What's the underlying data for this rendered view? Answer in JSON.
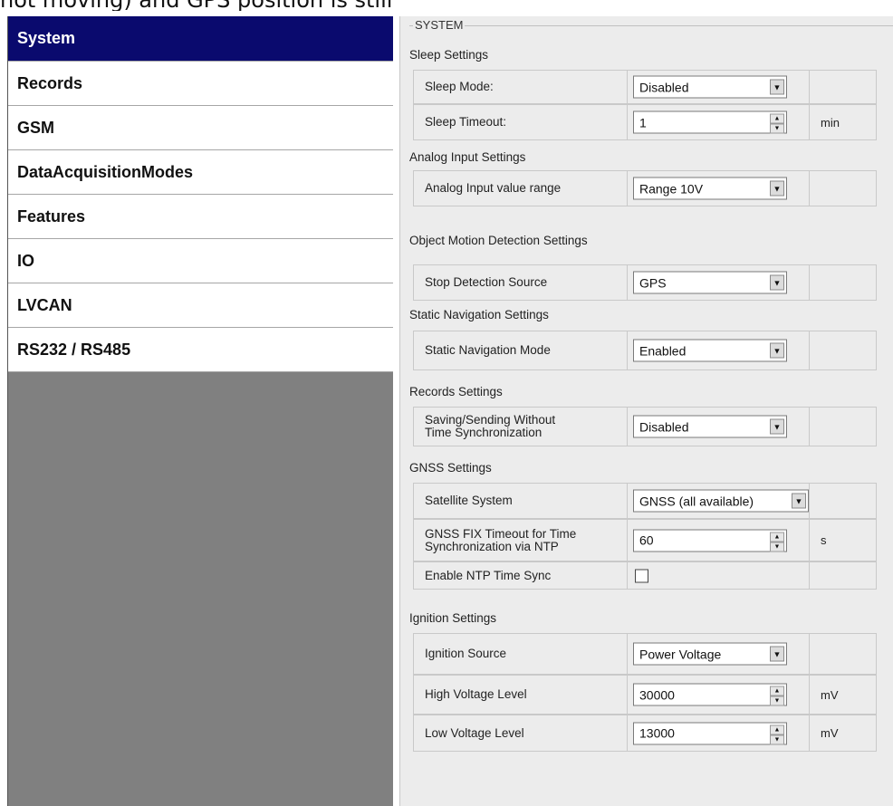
{
  "caption": "not moving) and GPS position is still traced.",
  "sidebar": {
    "items": [
      {
        "label": "System",
        "active": true
      },
      {
        "label": "Records"
      },
      {
        "label": "GSM"
      },
      {
        "label": "DataAcquisitionModes"
      },
      {
        "label": "Features"
      },
      {
        "label": "IO"
      },
      {
        "label": "LVCAN"
      },
      {
        "label": "RS232 / RS485"
      }
    ]
  },
  "panel": {
    "group_title": "SYSTEM",
    "sections": {
      "sleep": "Sleep Settings",
      "analog": "Analog Input Settings",
      "motion": "Object Motion Detection Settings",
      "static": "Static Navigation Settings",
      "records": "Records Settings",
      "gnss": "GNSS Settings",
      "ignition": "Ignition Settings"
    },
    "rows": {
      "sleep_mode": {
        "label": "Sleep Mode:",
        "value": "Disabled"
      },
      "sleep_timeout": {
        "label": "Sleep Timeout:",
        "value": "1",
        "unit": "min"
      },
      "analog_range": {
        "label": "Analog Input value range",
        "value": "Range 10V"
      },
      "stop_source": {
        "label": "Stop Detection Source",
        "value": "GPS"
      },
      "static_mode": {
        "label": "Static Navigation Mode",
        "value": "Enabled"
      },
      "saving_sending": {
        "label_line1": "Saving/Sending Without",
        "label_line2": "Time Synchronization",
        "value": "Disabled"
      },
      "satellite": {
        "label": "Satellite System",
        "value": "GNSS (all available)"
      },
      "gnss_fix": {
        "label_line1": "GNSS FIX Timeout for Time",
        "label_line2": "Synchronization via NTP",
        "value": "60",
        "unit": "s"
      },
      "ntp_sync": {
        "label": "Enable NTP Time Sync",
        "checked": false
      },
      "ign_source": {
        "label": "Ignition Source",
        "value": "Power Voltage"
      },
      "high_voltage": {
        "label": "High Voltage Level",
        "value": "30000",
        "unit": "mV"
      },
      "low_voltage": {
        "label": "Low Voltage Level",
        "value": "13000",
        "unit": "mV"
      }
    }
  },
  "icons": {
    "dropdown": "chevron-down-icon",
    "spinner": "spinner-icon"
  }
}
